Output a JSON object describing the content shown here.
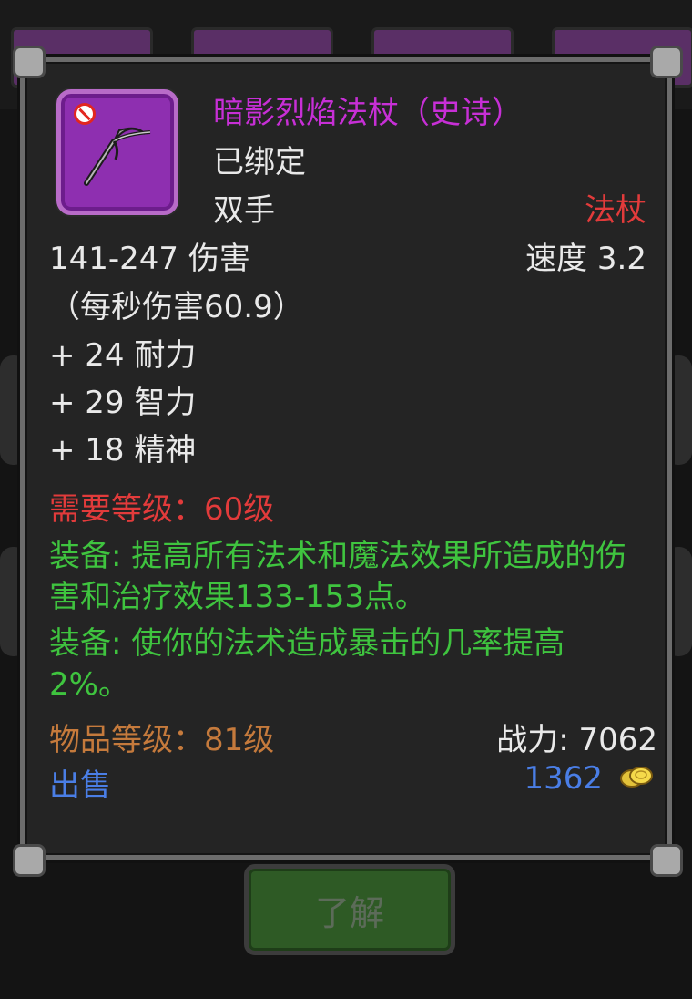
{
  "item": {
    "name": "暗影烈焰法杖（史诗）",
    "binding": "已绑定",
    "hand": "双手",
    "weapon_type": "法杖",
    "damage": "141-247 伤害",
    "speed": "速度 3.2",
    "dps": "（每秒伤害60.9）",
    "stats": [
      "+ 24 耐力",
      "+ 29 智力",
      "+ 18 精神"
    ],
    "requirement": "需要等级：60级",
    "equip_effects": [
      "装备: 提高所有法术和魔法效果所造成的伤害和治疗效果133-153点。",
      "装备: 使你的法术造成暴击的几率提高2%。"
    ],
    "item_level": "物品等级：81级",
    "power": "战力: 7062",
    "sell_label": "出售",
    "price": "1362"
  },
  "background": {
    "learn_button": "了解"
  },
  "colors": {
    "epic": "#c72fd6",
    "requirement": "#e23b3b",
    "equip": "#3fc43f",
    "item_level": "#c57a3c",
    "sell": "#4a7ee6"
  },
  "icons": {
    "item_icon": "staff-icon",
    "bound_marker": "no-sign-icon",
    "currency": "gold-coin-icon"
  }
}
